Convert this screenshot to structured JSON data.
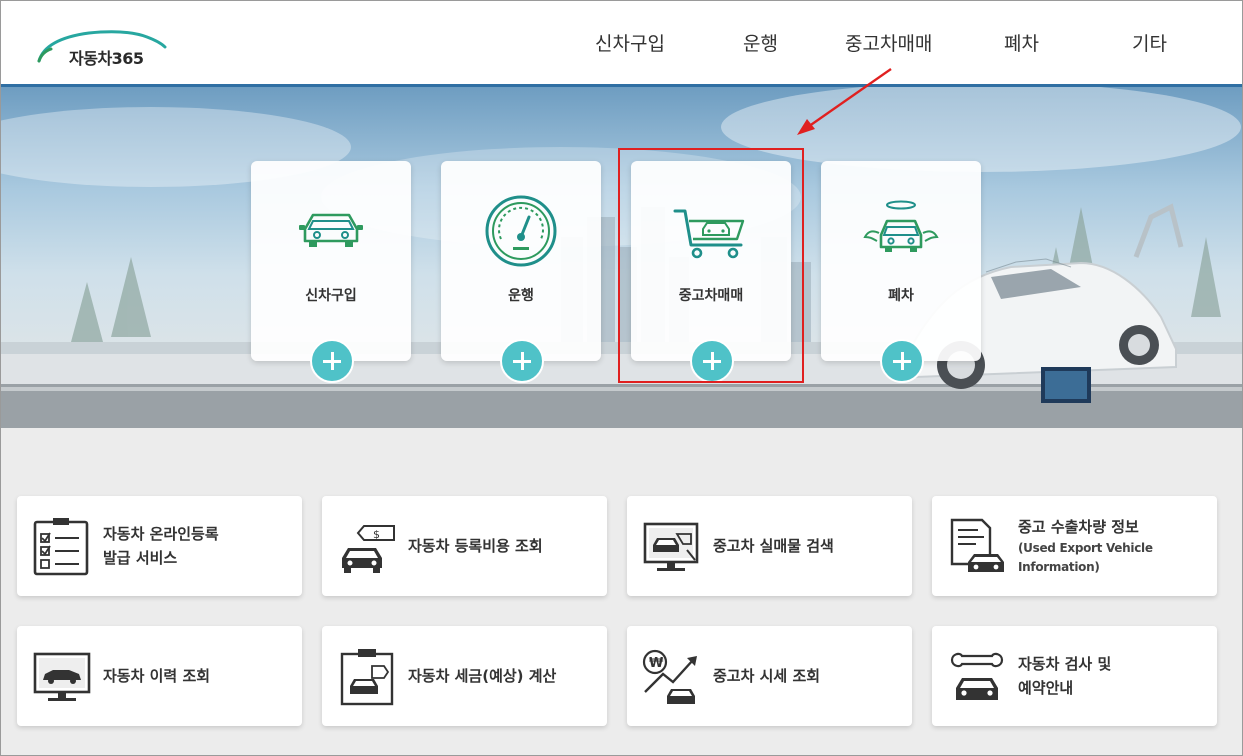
{
  "brand": {
    "logo_text": "자동차365"
  },
  "nav": [
    {
      "label": "신차구입"
    },
    {
      "label": "운행"
    },
    {
      "label": "중고차매매"
    },
    {
      "label": "폐차"
    },
    {
      "label": "기타"
    }
  ],
  "hero_cards": [
    {
      "label": "신차구입",
      "icon": "car-icon"
    },
    {
      "label": "운행",
      "icon": "speedometer-icon"
    },
    {
      "label": "중고차매매",
      "icon": "cart-car-icon"
    },
    {
      "label": "폐차",
      "icon": "angel-car-icon"
    }
  ],
  "annotation": {
    "highlight_color": "#e02020",
    "target": "중고차매매"
  },
  "services": [
    {
      "line1": "자동차 온라인등록",
      "line2": "발급 서비스",
      "icon": "checklist-icon"
    },
    {
      "line1": "자동차 등록비용 조회",
      "line2": "",
      "icon": "price-tag-car-icon"
    },
    {
      "line1": "중고차 실매물 검색",
      "line2": "",
      "icon": "monitor-car-search-icon"
    },
    {
      "line1": "중고 수출차량 정보",
      "line2": "(Used Export Vehicle",
      "line3": "Information)",
      "icon": "document-car-icon"
    },
    {
      "line1": "자동차 이력 조회",
      "line2": "",
      "icon": "monitor-car-icon"
    },
    {
      "line1": "자동차 세금(예상) 계산",
      "line2": "",
      "icon": "clipboard-car-icon"
    },
    {
      "line1": "중고차 시세 조회",
      "line2": "",
      "icon": "won-chart-car-icon"
    },
    {
      "line1": "자동차 검사 및",
      "line2": "예약안내",
      "icon": "wrench-car-icon"
    }
  ],
  "colors": {
    "accent": "#4fc2c8",
    "icon_green": "#2e9a5e",
    "icon_teal": "#1f8f8a",
    "header_line": "#2f6fa3"
  }
}
